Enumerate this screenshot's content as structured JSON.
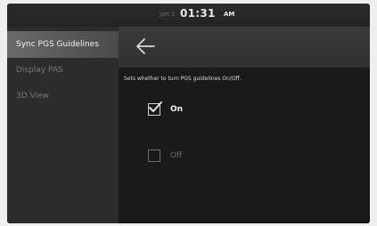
{
  "status": {
    "date": "Jan 1",
    "time": "01:31",
    "ampm": "AM"
  },
  "sidebar": {
    "items": [
      {
        "label": "Sync PGS Guidelines",
        "active": true
      },
      {
        "label": "Display PAS",
        "active": false
      },
      {
        "label": "3D View",
        "active": false
      }
    ]
  },
  "header": {
    "back_icon": "arrow-left-icon"
  },
  "settings": {
    "description": "Sets whether to turn PGS guidelines On/Off.",
    "options": [
      {
        "label": "On",
        "checked": true
      },
      {
        "label": "Off",
        "checked": false
      }
    ]
  }
}
